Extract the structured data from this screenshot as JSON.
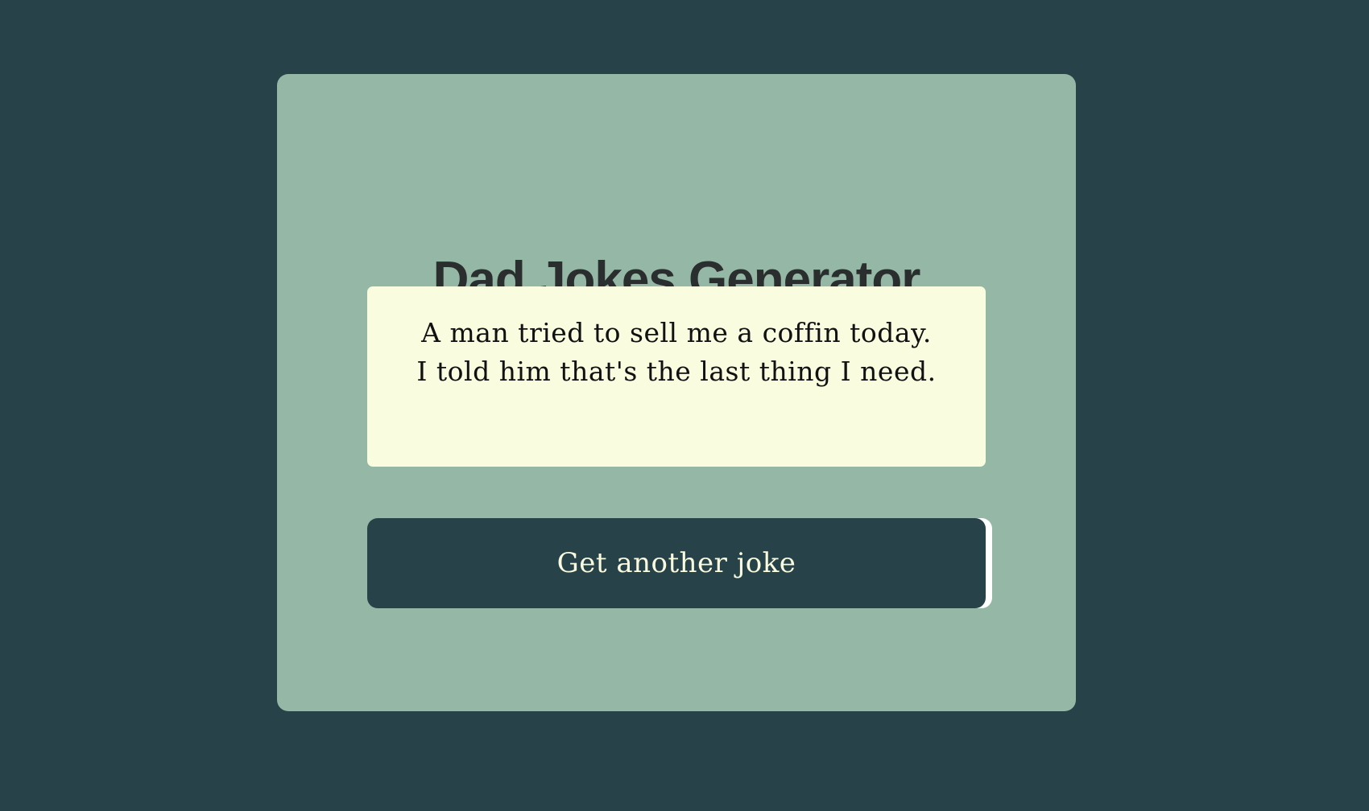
{
  "app": {
    "title": "Dad Jokes Generator"
  },
  "joke": {
    "lines": [
      "A man tried to sell me a coffin today.",
      "I told him that's the last thing I need."
    ]
  },
  "actions": {
    "next_joke_label": "Get another joke"
  },
  "colors": {
    "page_background": "#28424a",
    "card_background": "#95b7a5",
    "joke_background": "#f9fcdf",
    "button_background": "#28424a",
    "button_text": "#f9fcdf",
    "title_text": "#2b2e2f"
  }
}
